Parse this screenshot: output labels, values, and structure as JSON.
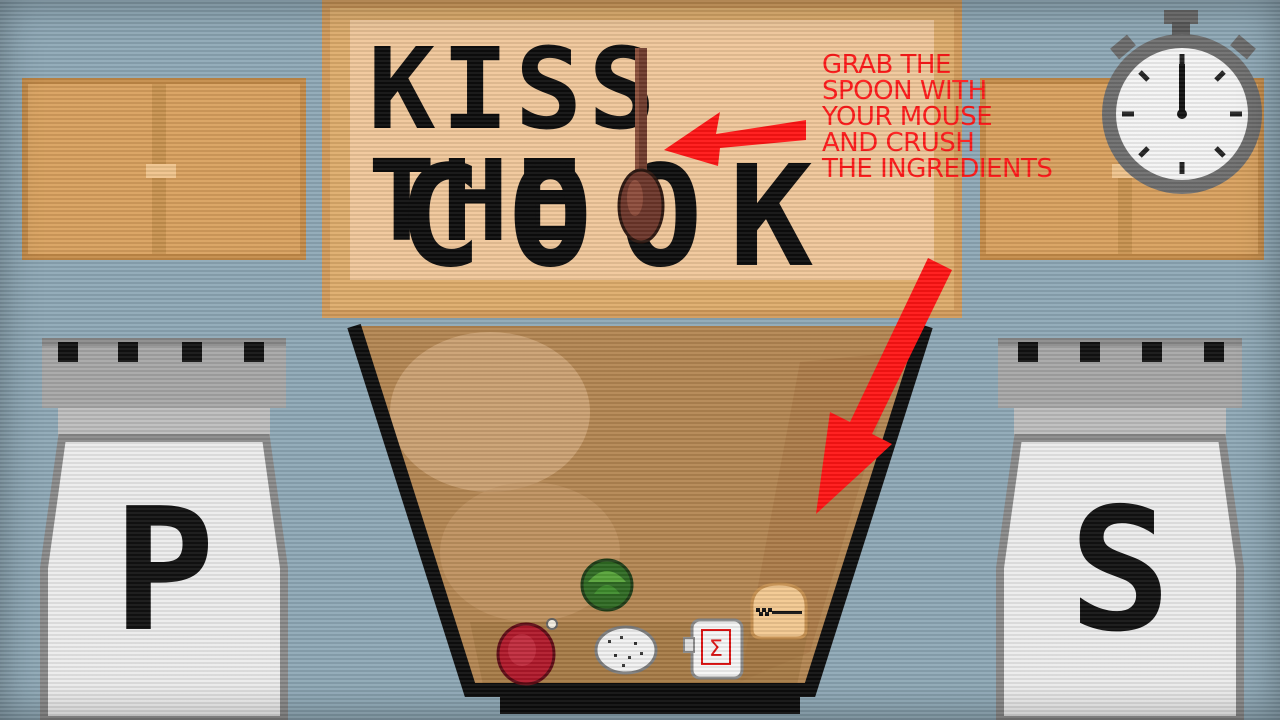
{
  "game": {
    "sign": {
      "line1": "KISS THE",
      "line2": "COOK"
    },
    "instruction": "GRAB THE\nSPOON WITH\nYOUR MOUSE\nAND CRUSH\nTHE INGREDIENTS",
    "pepper_label": "P",
    "salt_label": "S",
    "ingredients": [
      "brussels-sprout",
      "meat",
      "egg",
      "sugar-jar",
      "bread"
    ],
    "colors": {
      "instruction": "#ff1a1a",
      "wall": "#8ea8b6",
      "wood": "#d9a15e",
      "bowl": "#b48652"
    }
  }
}
